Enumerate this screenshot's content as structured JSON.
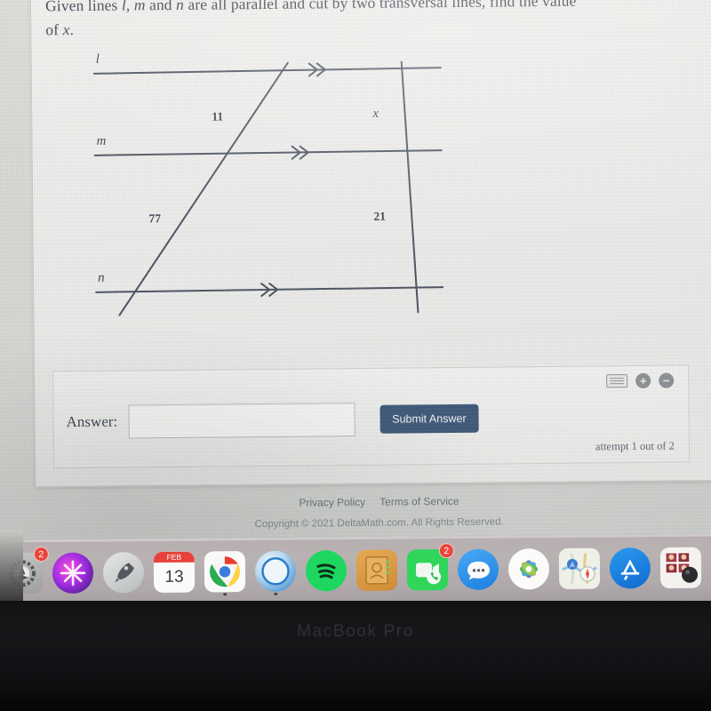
{
  "prompt": {
    "line1_a": "Given lines ",
    "var_l": "l",
    "sep1": ", ",
    "var_m": "m",
    "line1_b": " and ",
    "var_n": "n",
    "line1_c": " are all parallel and cut by two transversal lines, find the value",
    "line2_a": "of ",
    "var_x": "x",
    "line2_b": "."
  },
  "figure": {
    "line_labels": {
      "l": "l",
      "m": "m",
      "n": "n"
    },
    "segment_labels": {
      "upper_left": "11",
      "upper_right": "x",
      "lower_left": "77",
      "lower_right": "21"
    },
    "parallel_marker": "double-chevron",
    "stroke_color": "#4a5260"
  },
  "answer_panel": {
    "label": "Answer:",
    "input_value": "",
    "input_placeholder": "",
    "submit_label": "Submit Answer",
    "attempt_text": "attempt 1 out of 2",
    "tools": {
      "keyboard_icon": "keyboard-icon",
      "zoom_in": "+",
      "zoom_out": "−"
    },
    "button_color": "#3e5878"
  },
  "footer": {
    "privacy": "Privacy Policy",
    "terms": "Terms of Service",
    "copyright": "Copyright © 2021 DeltaMath.com. All Rights Reserved."
  },
  "dock": {
    "items": [
      {
        "name": "system-preferences",
        "badge": "2",
        "running": false
      },
      {
        "name": "siri",
        "badge": "",
        "running": false
      },
      {
        "name": "launchpad",
        "badge": "",
        "running": false
      },
      {
        "name": "calendar",
        "badge": "",
        "running": false,
        "month": "FEB",
        "day": "13"
      },
      {
        "name": "google-chrome",
        "badge": "",
        "running": true
      },
      {
        "name": "safari",
        "badge": "",
        "running": true
      },
      {
        "name": "spotify",
        "badge": "",
        "running": false
      },
      {
        "name": "contacts",
        "badge": "",
        "running": false
      },
      {
        "name": "facetime",
        "badge": "2",
        "running": false
      },
      {
        "name": "messages",
        "badge": "",
        "running": false
      },
      {
        "name": "photos",
        "badge": "",
        "running": false
      },
      {
        "name": "maps",
        "badge": "",
        "running": false
      },
      {
        "name": "app-store",
        "badge": "",
        "running": false
      },
      {
        "name": "photo-booth",
        "badge": "",
        "running": false
      }
    ]
  },
  "bezel": {
    "brand": "MacBook Pro"
  },
  "chart_data": {
    "type": "diagram",
    "title": "Three parallel lines cut by two transversals",
    "parallel_lines": [
      "l",
      "m",
      "n"
    ],
    "transversals": 2,
    "segments": [
      {
        "transversal": "left",
        "between": "l-m",
        "value": "11"
      },
      {
        "transversal": "left",
        "between": "m-n",
        "value": "77"
      },
      {
        "transversal": "right",
        "between": "l-m",
        "value": "x"
      },
      {
        "transversal": "right",
        "between": "m-n",
        "value": "21"
      }
    ],
    "unknown": "x"
  }
}
